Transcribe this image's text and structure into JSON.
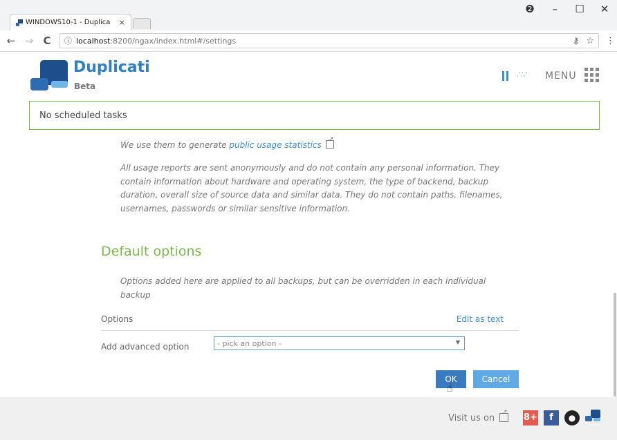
{
  "browser": {
    "tab_title": "WINDOWS10-1 - Duplica",
    "tab_close": "×",
    "window_controls": {
      "account": "❷",
      "minimize": "–",
      "maximize": "☐",
      "close": "✕"
    },
    "nav": {
      "back": "←",
      "forward": "→",
      "reload": "C"
    },
    "url_host": "localhost",
    "url_path": ":8200/ngax/index.html#/settings",
    "url_info_icon": "ⓘ",
    "key_icon": "⚷",
    "star_icon": "☆",
    "kebab_icon": "⋮"
  },
  "header": {
    "app_name": "Duplicati",
    "app_subtitle": "Beta",
    "menu_label": "MENU",
    "throttle_glyph": "∴∵"
  },
  "notice": {
    "text": "No scheduled tasks"
  },
  "usage": {
    "prefix": "We use them to generate ",
    "link_text": "public usage statistics",
    "anon_text": "All usage reports are sent anonymously and do not contain any personal information. They contain information about hardware and operating system, the type of backend, backup duration, overall size of source data and similar data. They do not contain paths, filenames, usernames, passwords or similar sensitive information."
  },
  "default_options": {
    "title": "Default options",
    "description": "Options added here are applied to all backups, but can be overridden in each individual backup",
    "options_label": "Options",
    "edit_as_text": "Edit as text",
    "add_advanced_label": "Add advanced option",
    "select_value": "- pick an option -",
    "select_caret": "▼"
  },
  "actions": {
    "ok_label": "OK",
    "cancel_label": "Cancel"
  },
  "footer": {
    "visit_label": "Visit us on",
    "gplus": "8+",
    "facebook": "f",
    "github": "●"
  },
  "colors": {
    "accent_blue": "#3a8fd6",
    "green": "#7ab84a",
    "ok_button": "#3a7bbf",
    "cancel_button": "#60a9e4"
  }
}
